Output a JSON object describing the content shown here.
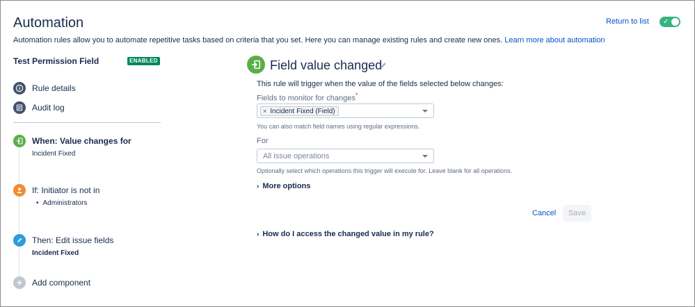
{
  "header": {
    "title": "Automation",
    "description": "Automation rules allow you to automate repetitive tasks based on criteria that you set. Here you can manage existing rules and create new ones.",
    "learn_more": "Learn more about automation",
    "return_link": "Return to list",
    "toggle_on": true
  },
  "sidebar": {
    "rule_name": "Test Permission Field",
    "status_badge": "ENABLED",
    "links": [
      {
        "label": "Rule details",
        "icon": "info-icon"
      },
      {
        "label": "Audit log",
        "icon": "document-icon"
      }
    ],
    "components": [
      {
        "title": "When: Value changes for",
        "detail": "Incident Fixed",
        "icon": "trigger-icon",
        "color": "#5AAE4A"
      },
      {
        "title": "If: Initiator is not in",
        "detail": "Administrators",
        "icon": "person-icon",
        "color": "#F18D30"
      },
      {
        "title": "Then: Edit issue fields",
        "detail": "Incident Fixed",
        "icon": "pencil-icon",
        "color": "#2D9CDB"
      }
    ],
    "add_component": "Add component"
  },
  "panel": {
    "title": "Field value changed",
    "description": "This rule will trigger when the value of the fields selected below changes:",
    "fields_label": "Fields to monitor for changes",
    "required_mark": "*",
    "selected_field": "Incident Fixed (Field)",
    "fields_help": "You can also match field names using regular expressions.",
    "for_label": "For",
    "operations_placeholder": "All issue operations",
    "operations_help": "Optionally select which operations this trigger will execute for. Leave blank for all operations.",
    "more_options": "More options",
    "cancel": "Cancel",
    "save": "Save",
    "faq": "How do I access the changed value in my rule?"
  },
  "colors": {
    "accent": "#0052CC",
    "enabled": "#00875A",
    "toggle": "#36B37E"
  }
}
